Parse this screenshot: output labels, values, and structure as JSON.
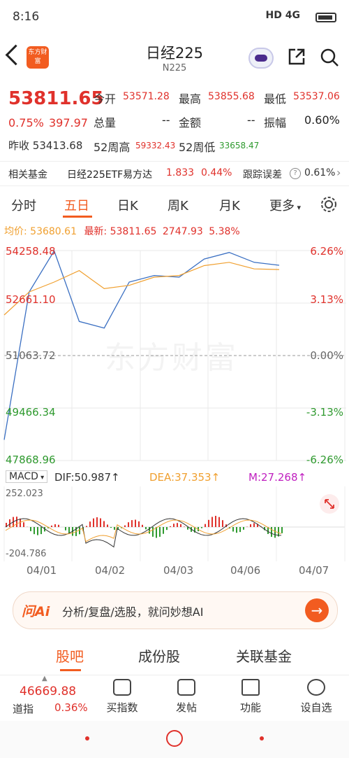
{
  "status": {
    "time": "8:16",
    "network": "HD 4G"
  },
  "header": {
    "title": "日经225",
    "subtitle": "N225",
    "logo_text": "东方财富"
  },
  "quote": {
    "price": "53811.65",
    "change_pct": "0.75%",
    "change": "397.97",
    "prev_close_label": "昨收",
    "prev_close": "53413.68",
    "open_label": "今开",
    "open": "53571.28",
    "high_label": "最高",
    "high": "53855.68",
    "low_label": "最低",
    "low": "53537.06",
    "volume_label": "总量",
    "volume": "--",
    "amount_label": "金额",
    "amount": "--",
    "amplitude_label": "振幅",
    "amplitude": "0.60%",
    "wk52_high_label": "52周高",
    "wk52_high": "59332.43",
    "wk52_low_label": "52周低",
    "wk52_low": "33658.47"
  },
  "fund": {
    "label": "相关基金",
    "name": "日经225ETF易方达",
    "price": "1.833",
    "change": "0.44%",
    "tracking_label": "跟踪误差",
    "help": "?",
    "tracking": "0.61%"
  },
  "tabs": [
    "分时",
    "五日",
    "日K",
    "周K",
    "月K",
    "更多"
  ],
  "active_tab": 1,
  "chart": {
    "avg_label": "均价:",
    "avg_value": "53680.61",
    "latest_label": "最新:",
    "latest_value": "53811.65",
    "latest_change": "2747.93",
    "latest_pct": "5.38%",
    "watermark": "东方财富",
    "y_left": [
      "54258.48",
      "52661.10",
      "51063.72",
      "49466.34",
      "47868.96"
    ],
    "y_right": [
      "6.26%",
      "3.13%",
      "0.00%",
      "-3.13%",
      "-6.26%"
    ],
    "colors": {
      "price": "#3a6fc2",
      "avg": "#f0a030",
      "up": "#e0312b",
      "down": "#2f9a2f"
    }
  },
  "chart_data": {
    "type": "line",
    "x": [
      "04/01",
      "04/02",
      "04/03",
      "04/06",
      "04/07"
    ],
    "series": [
      {
        "values": [
          48500,
          53000,
          54250,
          52100,
          51900,
          53300,
          53500,
          53450,
          54000,
          54200,
          53900,
          53811.65
        ]
      },
      {
        "values": [
          52300,
          53000,
          53300,
          53650,
          53100,
          53200,
          53450,
          53500,
          53800,
          53900,
          53700,
          53680.61
        ]
      }
    ],
    "ylim": [
      47868.96,
      54258.48
    ],
    "grid": true
  },
  "macd": {
    "selector": "MACD",
    "dif_label": "DIF:",
    "dif": "50.987",
    "dea_label": "DEA:",
    "dea": "37.353",
    "m_label": "M:",
    "m": "27.268",
    "arrow": "↑",
    "top": "252.023",
    "bottom": "-204.786",
    "colors": {
      "dif": "#333333",
      "dea": "#f0a030",
      "m": "#c020c0"
    }
  },
  "dates": [
    "04/01",
    "04/02",
    "04/03",
    "04/06",
    "04/07"
  ],
  "ai": {
    "logo": "问Ai",
    "text": "分析/复盘/选股，就问妙想AI"
  },
  "lower_tabs": [
    "股吧",
    "成份股",
    "关联基金"
  ],
  "bottom": {
    "index_value": "46669.88",
    "index_name": "道指",
    "index_pct": "0.36%",
    "items": [
      "买指数",
      "发帖",
      "功能",
      "设自选"
    ]
  }
}
